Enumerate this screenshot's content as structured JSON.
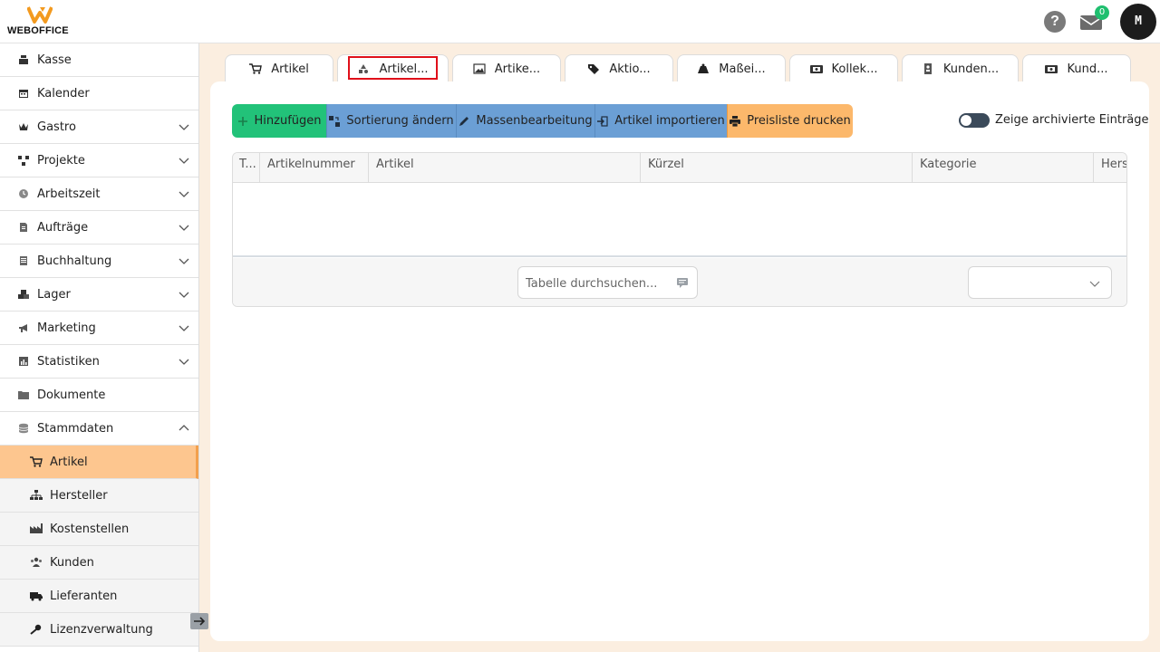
{
  "app": {
    "name": "WEBOFFICE"
  },
  "header": {
    "help_label": "?",
    "mail_count": "0",
    "avatar_initial": "M"
  },
  "sidebar": {
    "items": [
      {
        "label": "Kasse",
        "icon": "cash-register-icon",
        "expandable": false
      },
      {
        "label": "Kalender",
        "icon": "calendar-icon",
        "expandable": false
      },
      {
        "label": "Gastro",
        "icon": "crown-icon",
        "expandable": true
      },
      {
        "label": "Projekte",
        "icon": "project-icon",
        "expandable": true
      },
      {
        "label": "Arbeitszeit",
        "icon": "clock-icon",
        "expandable": true
      },
      {
        "label": "Aufträge",
        "icon": "document-icon",
        "expandable": true
      },
      {
        "label": "Buchhaltung",
        "icon": "ledger-icon",
        "expandable": true
      },
      {
        "label": "Lager",
        "icon": "boxes-icon",
        "expandable": true
      },
      {
        "label": "Marketing",
        "icon": "megaphone-icon",
        "expandable": true
      },
      {
        "label": "Statistiken",
        "icon": "chart-icon",
        "expandable": true
      },
      {
        "label": "Dokumente",
        "icon": "folder-icon",
        "expandable": false
      },
      {
        "label": "Stammdaten",
        "icon": "database-icon",
        "expandable": true,
        "expanded": true
      }
    ],
    "subitems": [
      {
        "label": "Artikel",
        "icon": "cart-icon",
        "active": true
      },
      {
        "label": "Hersteller",
        "icon": "hierarchy-icon"
      },
      {
        "label": "Kostenstellen",
        "icon": "industry-icon"
      },
      {
        "label": "Kunden",
        "icon": "users-icon"
      },
      {
        "label": "Lieferanten",
        "icon": "truck-icon"
      },
      {
        "label": "Lizenzverwaltung",
        "icon": "key-icon"
      }
    ]
  },
  "tabs": [
    {
      "label": "Artikel",
      "icon": "cart-icon"
    },
    {
      "label": "Artikel...",
      "icon": "shapes-icon"
    },
    {
      "label": "Artike...",
      "icon": "image-icon"
    },
    {
      "label": "Aktio...",
      "icon": "tag-icon"
    },
    {
      "label": "Maßei...",
      "icon": "weight-icon"
    },
    {
      "label": "Kollek...",
      "icon": "collection-icon"
    },
    {
      "label": "Kunden...",
      "icon": "contact-icon"
    },
    {
      "label": "Kund...",
      "icon": "collection-icon"
    }
  ],
  "toolbar": {
    "add_label": "Hinzufügen",
    "sort_label": "Sortierung ändern",
    "bulk_edit_label": "Massenbearbeitung",
    "import_label": "Artikel importieren",
    "print_label": "Preisliste drucken",
    "archive_toggle_label": "Zeige archivierte Einträge"
  },
  "table": {
    "columns": [
      "T...",
      "Artikelnummer",
      "Artikel",
      "Kürzel",
      "Kategorie",
      "Herst"
    ],
    "rows": []
  },
  "footer": {
    "search_placeholder": "Tabelle durchsuchen...",
    "page_size_value": ""
  },
  "colors": {
    "accent_orange": "#fdc68f",
    "green": "#22c279",
    "blue": "#6b9fd5",
    "orange": "#fcb86b",
    "highlight_red": "#e0101a"
  }
}
